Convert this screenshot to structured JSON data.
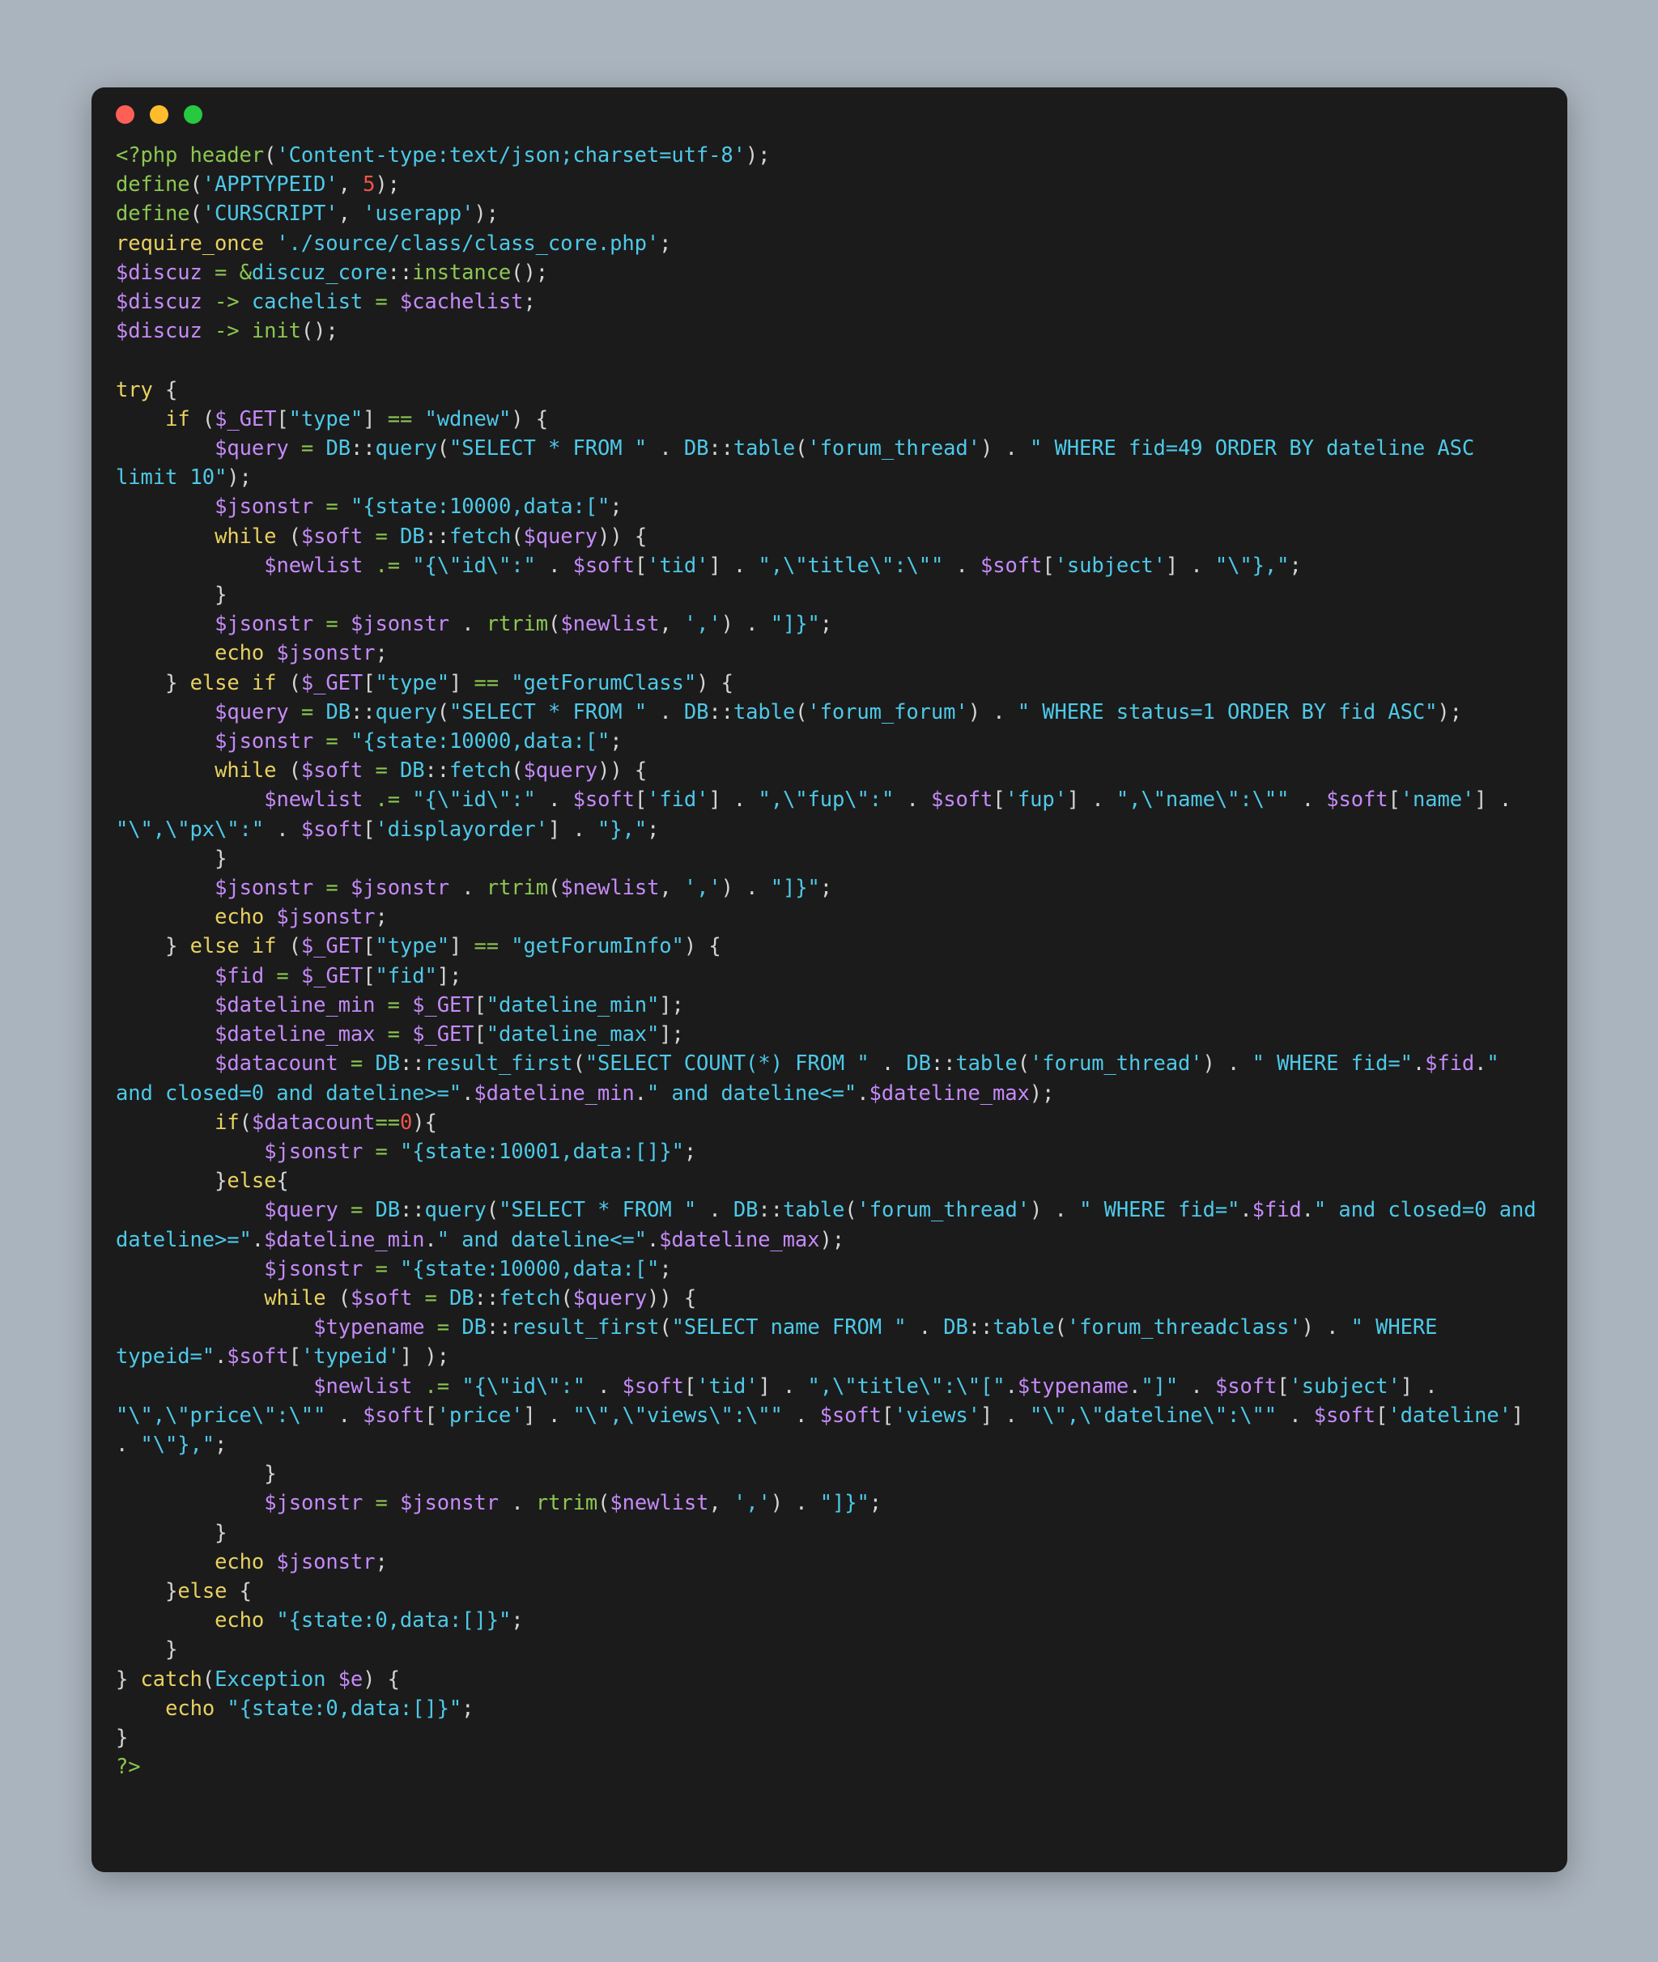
{
  "window": {
    "name": "code-editor-window",
    "background": "#1b1b1b",
    "page_background": "#aab4be",
    "traffic_lights": [
      {
        "name": "close",
        "color": "#ff5f56"
      },
      {
        "name": "minimize",
        "color": "#ffbd2e"
      },
      {
        "name": "maximize",
        "color": "#27c93f"
      }
    ]
  },
  "theme": {
    "keyword": "#e8d161",
    "function": "#8cc751",
    "variable": "#c58af9",
    "string": "#4ec9e8",
    "operator": "#8cc751",
    "number": "#f0544c",
    "punctuation": "#d4d4d4",
    "tag": "#8cc751"
  },
  "code": {
    "language": "php",
    "lines": [
      "<?php header('Content-type:text/json;charset=utf-8');",
      "define('APPTYPEID', 5);",
      "define('CURSCRIPT', 'userapp');",
      "require_once './source/class/class_core.php';",
      "$discuz = &discuz_core::instance();",
      "$discuz -> cachelist = $cachelist;",
      "$discuz -> init();",
      "",
      "try {",
      "    if ($_GET[\"type\"] == \"wdnew\") {",
      "        $query = DB::query(\"SELECT * FROM \" . DB::table('forum_thread') . \" WHERE fid=49 ORDER BY dateline ASC limit 10\");",
      "        $jsonstr = \"{state:10000,data:[\";",
      "        while ($soft = DB::fetch($query)) {",
      "            $newlist .= \"{\\\"id\\\":\" . $soft['tid'] . \",\\\"title\\\":\\\"\" . $soft['subject'] . \"\\\"},\";",
      "        }",
      "        $jsonstr = $jsonstr . rtrim($newlist, ',') . \"]}\";",
      "        echo $jsonstr;",
      "    } else if ($_GET[\"type\"] == \"getForumClass\") {",
      "        $query = DB::query(\"SELECT * FROM \" . DB::table('forum_forum') . \" WHERE status=1 ORDER BY fid ASC\");",
      "        $jsonstr = \"{state:10000,data:[\";",
      "        while ($soft = DB::fetch($query)) {",
      "            $newlist .= \"{\\\"id\\\":\" . $soft['fid'] . \",\\\"fup\\\":\" . $soft['fup'] . \",\\\"name\\\":\\\"\" . $soft['name'] . \"\\\",\\\"px\\\":\" . $soft['displayorder'] . \"},\";",
      "        }",
      "        $jsonstr = $jsonstr . rtrim($newlist, ',') . \"]}\";",
      "        echo $jsonstr;",
      "    } else if ($_GET[\"type\"] == \"getForumInfo\") {",
      "        $fid = $_GET[\"fid\"];",
      "        $dateline_min = $_GET[\"dateline_min\"];",
      "        $dateline_max = $_GET[\"dateline_max\"];",
      "        $datacount = DB::result_first(\"SELECT COUNT(*) FROM \" . DB::table('forum_thread') . \" WHERE fid=\".$fid.\" and closed=0 and dateline>=\".$dateline_min.\" and dateline<=\".$dateline_max);",
      "        if($datacount==0){",
      "            $jsonstr = \"{state:10001,data:[]}\";",
      "        }else{",
      "            $query = DB::query(\"SELECT * FROM \" . DB::table('forum_thread') . \" WHERE fid=\".$fid.\" and closed=0 and dateline>=\".$dateline_min.\" and dateline<=\".$dateline_max);",
      "            $jsonstr = \"{state:10000,data:[\";",
      "            while ($soft = DB::fetch($query)) {",
      "                $typename = DB::result_first(\"SELECT name FROM \" . DB::table('forum_threadclass') . \" WHERE typeid=\".$soft['typeid'] );",
      "                $newlist .= \"{\\\"id\\\":\" . $soft['tid'] . \",\\\"title\\\":\\\"[\".$typename.\"]\" . $soft['subject'] . \"\\\",\\\"price\\\":\\\"\" . $soft['price'] . \"\\\",\\\"views\\\":\\\"\" . $soft['views'] . \"\\\",\\\"dateline\\\":\\\"\" . $soft['dateline'] . \"\\\"},\";",
      "            }",
      "            $jsonstr = $jsonstr . rtrim($newlist, ',') . \"]}\";",
      "        }",
      "        echo $jsonstr;",
      "    }else {",
      "        echo \"{state:0,data:[]}\";",
      "    }",
      "} catch(Exception $e) {",
      "    echo \"{state:0,data:[]}\";",
      "}",
      "?>"
    ]
  }
}
